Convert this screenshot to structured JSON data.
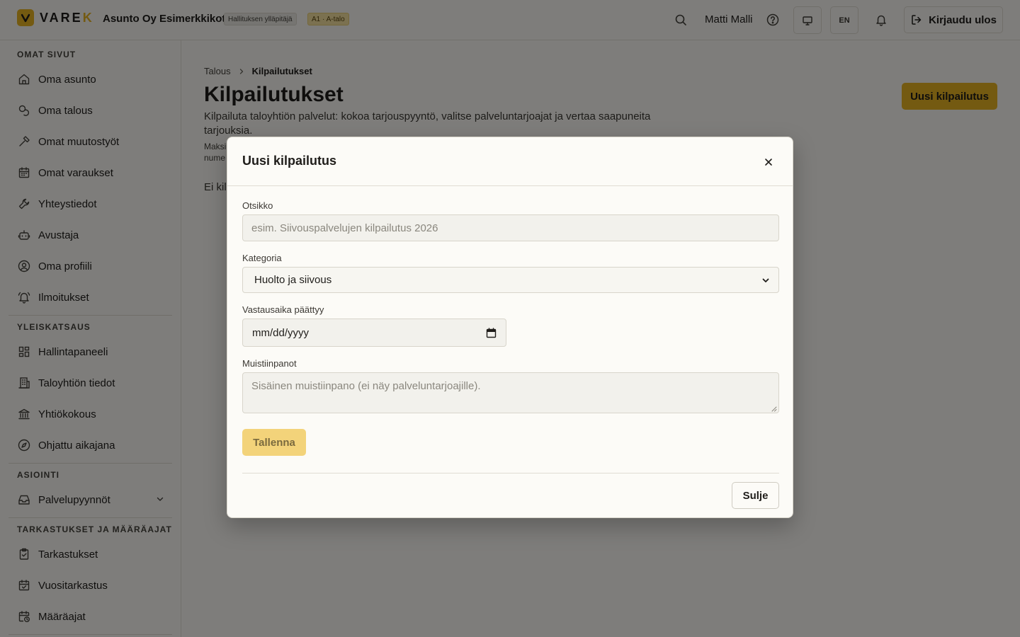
{
  "header": {
    "logo_text_main": "VARE",
    "logo_text_accent": "K",
    "org_name": "Asunto Oy Esimerkkikoti",
    "role_badge": "Hallituksen ylläpitäjä",
    "building_badge": "A1 · A-talo",
    "user_name": "Matti Malli",
    "language_button": "EN",
    "logout_label": "Kirjaudu ulos"
  },
  "sidebar": {
    "sections": [
      {
        "title": "OMAT SIVUT",
        "items": [
          {
            "label": "Oma asunto",
            "icon": "home-icon"
          },
          {
            "label": "Oma talous",
            "icon": "coins-icon"
          },
          {
            "label": "Omat muutostyöt",
            "icon": "hammer-icon"
          },
          {
            "label": "Omat varaukset",
            "icon": "calendar-icon"
          },
          {
            "label": "Yhteystiedot",
            "icon": "wrench-icon"
          },
          {
            "label": "Avustaja",
            "icon": "bot-icon"
          },
          {
            "label": "Oma profiili",
            "icon": "user-circle-icon"
          },
          {
            "label": "Ilmoitukset",
            "icon": "bell-ring-icon"
          }
        ]
      },
      {
        "title": "YLEISKATSAUS",
        "items": [
          {
            "label": "Hallintapaneeli",
            "icon": "dashboard-icon"
          },
          {
            "label": "Taloyhtiön tiedot",
            "icon": "building-icon"
          },
          {
            "label": "Yhtiökokous",
            "icon": "landmark-icon"
          },
          {
            "label": "Ohjattu aikajana",
            "icon": "compass-icon"
          }
        ]
      },
      {
        "title": "ASIOINTI",
        "items": [
          {
            "label": "Palvelupyynnöt",
            "icon": "inbox-icon"
          }
        ]
      },
      {
        "title": "TARKASTUKSET JA MÄÄRÄAJAT",
        "items": [
          {
            "label": "Tarkastukset",
            "icon": "clipboard-check-icon"
          },
          {
            "label": "Vuositarkastus",
            "icon": "calendar-check-icon"
          },
          {
            "label": "Määräajat",
            "icon": "calendar-clock-icon"
          }
        ]
      }
    ]
  },
  "main": {
    "breadcrumb": {
      "parent": "Talous",
      "current": "Kilpailutukset"
    },
    "title": "Kilpailutukset",
    "description": "Kilpailuta taloyhtiön palvelut: kokoa tarjouspyyntö, valitse palveluntarjoajat ja vertaa saapuneita tarjouksia.",
    "hint_line1": "Maksi",
    "hint_line2": "nume",
    "empty_text": "Ei kilp",
    "new_button": "Uusi kilpailutus"
  },
  "modal": {
    "title": "Uusi kilpailutus",
    "fields": {
      "title_label": "Otsikko",
      "title_placeholder": "esim. Siivouspalvelujen kilpailutus 2026",
      "category_label": "Kategoria",
      "category_value": "Huolto ja siivous",
      "deadline_label": "Vastausaika päättyy",
      "deadline_value": "mm/dd/yyyy",
      "notes_label": "Muistiinpanot",
      "notes_placeholder": "Sisäinen muistiinpano (ei näy palveluntarjoajille)."
    },
    "save_button": "Tallenna",
    "close_button": "Sulje"
  },
  "colors": {
    "accent": "#e8b422",
    "background": "#fcfbf7",
    "overlay": "rgba(0,0,0,0.5)"
  }
}
